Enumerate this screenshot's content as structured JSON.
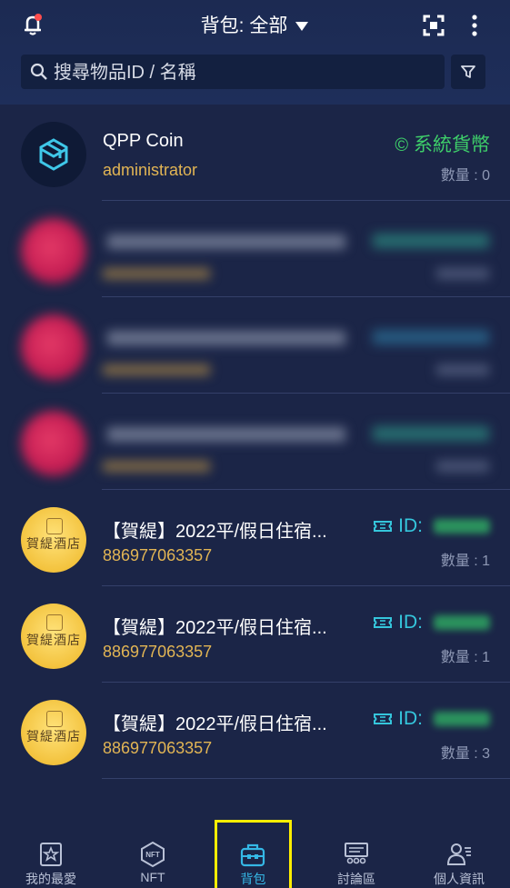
{
  "header": {
    "title": "背包: 全部",
    "icons": {
      "left": "notification-bell-icon",
      "scan": "scan-icon",
      "more": "more-vertical-icon"
    }
  },
  "search": {
    "placeholder": "搜尋物品ID / 名稱",
    "icon": "search-icon",
    "filter_icon": "filter-icon"
  },
  "items": [
    {
      "name": "QPP Coin",
      "subtitle": "administrator",
      "tag": "系統貨幣",
      "tag_icon": "copyright-icon",
      "quantity": "數量 : 0",
      "blurred": false
    },
    {
      "blurred": true
    },
    {
      "blurred": true
    },
    {
      "blurred": true
    },
    {
      "name": "【賀緹】2022平/假日住宿...",
      "subtitle": "886977063357",
      "id_label": "ID:",
      "id_icon": "ticket-icon",
      "quantity": "數量 : 1",
      "avatar_text": "賀緹酒店",
      "blurred": false
    },
    {
      "name": "【賀緹】2022平/假日住宿...",
      "subtitle": "886977063357",
      "id_label": "ID:",
      "id_icon": "ticket-icon",
      "quantity": "數量 : 1",
      "avatar_text": "賀緹酒店",
      "blurred": false
    },
    {
      "name": "【賀緹】2022平/假日住宿...",
      "subtitle": "886977063357",
      "id_label": "ID:",
      "id_icon": "ticket-icon",
      "quantity": "數量 : 3",
      "avatar_text": "賀緹酒店",
      "blurred": false
    }
  ],
  "tabs": [
    {
      "label": "我的最愛",
      "icon": "favorites-icon",
      "active": false
    },
    {
      "label": "NFT",
      "icon": "nft-icon",
      "active": false
    },
    {
      "label": "背包",
      "icon": "backpack-icon",
      "active": true
    },
    {
      "label": "討論區",
      "icon": "forum-icon",
      "active": false
    },
    {
      "label": "個人資訊",
      "icon": "profile-icon",
      "active": false
    }
  ],
  "colors": {
    "background": "#1b2547",
    "accent_gold": "#e2b554",
    "accent_green": "#3ecf6a",
    "accent_cyan": "#35c6dc",
    "active_tab": "#35b8e6",
    "highlight": "#ffee00"
  }
}
